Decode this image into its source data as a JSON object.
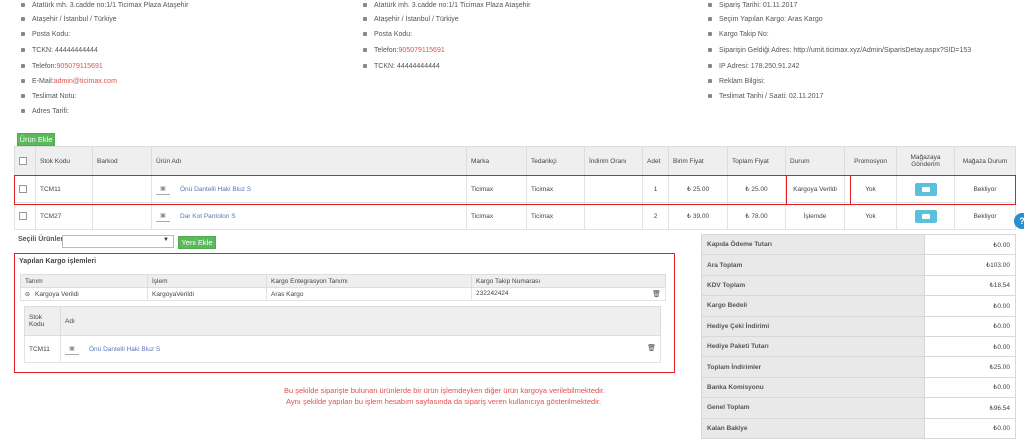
{
  "address_col1": [
    "Atatürk mh. 3.cadde no:1/1 Ticimax Plaza Ataşehir",
    "Ataşehir / İstanbul / Türkiye",
    "Posta Kodu:",
    "TCKN: 44444444444",
    {
      "label": "Telefon: ",
      "value": "905079115691"
    },
    {
      "label": "E-Mail: ",
      "value": "admin@ticimax.com"
    },
    "Teslimat Notu:",
    "Adres Tarifi:"
  ],
  "address_col2": [
    "Atatürk mh. 3.cadde no:1/1 Ticimax Plaza Ataşehir",
    "Ataşehir / İstanbul / Türkiye",
    "Posta Kodu:",
    {
      "label": "Telefon: ",
      "value": "905079115691"
    },
    "TCKN: 44444444444"
  ],
  "order_info": [
    "Sipariş Tarihi: 01.11.2017",
    "Seçim Yapılan Kargo: Aras Kargo",
    "Kargo Takip No:",
    "Siparişin Geldiği Adres: http://umit.ticimax.xyz/Admin/SiparisDetay.aspx?SID=153",
    "IP Adresi: 178.250.91.242",
    "Reklam Bilgisi:",
    "Teslimat Tarihi / Saati: 02.11.2017"
  ],
  "add_product_button": "Ürün Ekle",
  "products_table": {
    "headers": [
      "Stok Kodu",
      "Barkod",
      "Ürün Adı",
      "Marka",
      "Tedarikçi",
      "İndirim Oranı",
      "Adet",
      "Birim Fiyat",
      "Toplam Fiyat",
      "Durum",
      "Promosyon",
      "Mağazaya Gönderim",
      "Mağaza Durum"
    ],
    "rows": [
      {
        "stock": "TCM11",
        "barcode": "",
        "name": "Önü Dantelli Haki Bluz S",
        "brand": "Ticimax",
        "supplier": "Ticimax",
        "discount": "",
        "qty": "1",
        "unit_price": "₺ 25.00",
        "total": "₺ 25.00",
        "status": "Kargoya Verildi",
        "promo": "Yok",
        "store_status": "Bekliyor"
      },
      {
        "stock": "TCM27",
        "barcode": "",
        "name": "Dar Kot Pantolon S",
        "brand": "Ticimax",
        "supplier": "Ticimax",
        "discount": "",
        "qty": "2",
        "unit_price": "₺ 39.00",
        "total": "₺ 78.00",
        "status": "İşlemde",
        "promo": "Yok",
        "store_status": "Bekliyor"
      }
    ]
  },
  "selected_products_label": "Seçili Ürünler",
  "new_add_button": "Yeni Ekle",
  "cargo": {
    "title": "Yapılan Kargo işlemleri",
    "headers": [
      "Tanım",
      "İşlem",
      "Kargo Entegrasyon Tanımı",
      "Kargo Takip Numarası"
    ],
    "row": {
      "tanim": "Kargoya Verildi",
      "islem": "KargoyaVerildi",
      "entegrasyon": "Aras Kargo",
      "takip": "232242424"
    },
    "inner_headers": [
      "Stok Kodu",
      "Adı"
    ],
    "inner_row": {
      "stock": "TCM11",
      "name": "Önü Dantelli Haki Bluz S"
    }
  },
  "summary": [
    {
      "label": "Kapıda Ödeme Tutarı",
      "value": "₺0.00"
    },
    {
      "label": "Ara Toplam",
      "value": "₺103.00"
    },
    {
      "label": "KDV Toplam",
      "value": "₺18.54"
    },
    {
      "label": "Kargo Bedeli",
      "value": "₺0.00"
    },
    {
      "label": "Hediye Çeki İndirimi",
      "value": "₺0.00"
    },
    {
      "label": "Hediye Paketi Tutarı",
      "value": "₺0.00"
    },
    {
      "label": "Toplam İndirimler",
      "value": "₺25.00"
    },
    {
      "label": "Banka Komisyonu",
      "value": "₺0.00"
    },
    {
      "label": "Genel Toplam",
      "value": "₺96.54"
    },
    {
      "label": "Kalan Bakiye",
      "value": "₺0.00"
    }
  ],
  "note_lines": [
    "Bu şekilde siparişte bulunan ürünlerde bir ürün işlemdeyken diğer ürün kargoya verilebilmektedir.",
    "Aynı şekilde yapılan bu işlem hesabım sayfasında da sipariş veren kullanıcıya gösterilmektedir."
  ],
  "help_label": "?"
}
